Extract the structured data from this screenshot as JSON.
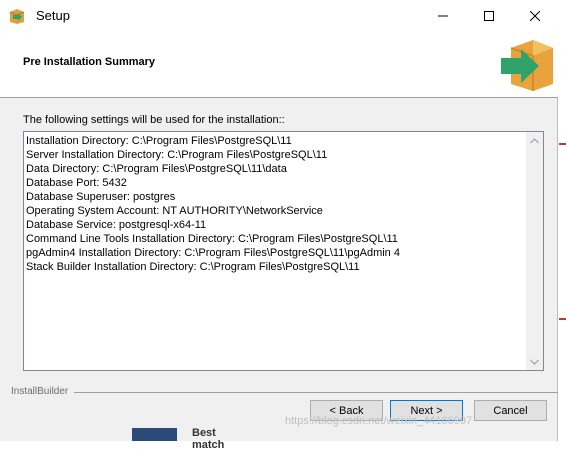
{
  "window": {
    "title": "Setup",
    "controls": [
      "minimize",
      "maximize",
      "close"
    ]
  },
  "header": {
    "title": "Pre Installation Summary",
    "logo_icon": "installer-box-arrow-icon"
  },
  "body": {
    "intro": "The following settings will be used for the installation::",
    "settings": [
      "Installation Directory: C:\\Program Files\\PostgreSQL\\11",
      "Server Installation Directory: C:\\Program Files\\PostgreSQL\\11",
      "Data Directory: C:\\Program Files\\PostgreSQL\\11\\data",
      "Database Port: 5432",
      "Database Superuser: postgres",
      "Operating System Account: NT AUTHORITY\\NetworkService",
      "Database Service: postgresql-x64-11",
      "Command Line Tools Installation Directory: C:\\Program Files\\PostgreSQL\\11",
      "pgAdmin4 Installation Directory: C:\\Program Files\\PostgreSQL\\11\\pgAdmin 4",
      "Stack Builder Installation Directory: C:\\Program Files\\PostgreSQL\\11"
    ]
  },
  "footer": {
    "brand": "InstallBuilder",
    "back_label": "< Back",
    "next_label": "Next >",
    "cancel_label": "Cancel"
  },
  "overlay": {
    "watermark": "https://blog.csdn.net/weixin_44166997",
    "behind_window_text": "Best match"
  },
  "colors": {
    "accent": "#0078d7",
    "logo_box": "#e8a33c",
    "logo_arrow": "#2ea36b"
  }
}
